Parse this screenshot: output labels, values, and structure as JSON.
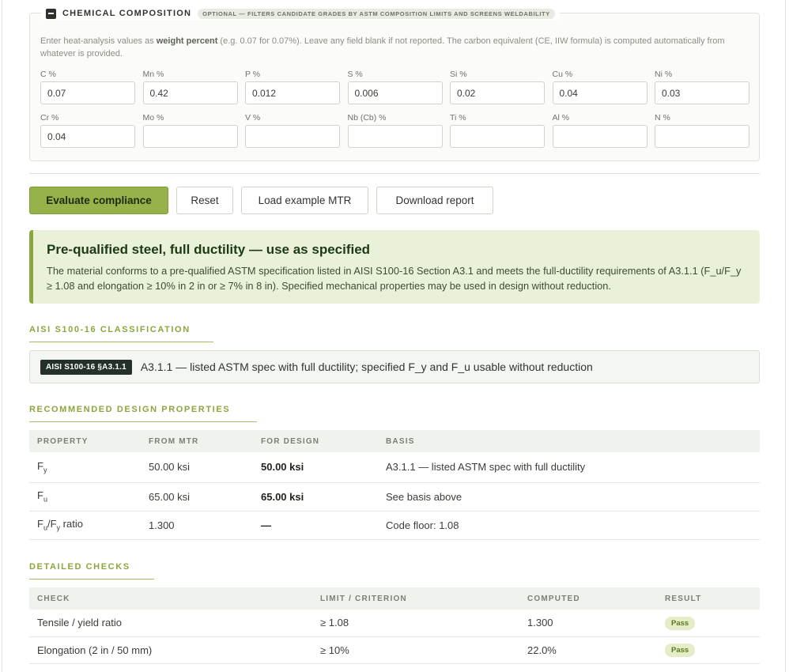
{
  "composition": {
    "title": "CHEMICAL COMPOSITION",
    "pill": "OPTIONAL — FILTERS CANDIDATE GRADES BY ASTM COMPOSITION LIMITS AND SCREENS WELDABILITY",
    "hint_pre": "Enter heat-analysis values as ",
    "hint_bold": "weight percent",
    "hint_post": " (e.g. 0.07 for 0.07%). Leave any field blank if not reported. The carbon equivalent (CE, IIW formula) is computed automatically from whatever is provided.",
    "fields": [
      {
        "label": "C %",
        "value": "0.07"
      },
      {
        "label": "Mn %",
        "value": "0.42"
      },
      {
        "label": "P %",
        "value": "0.012"
      },
      {
        "label": "S %",
        "value": "0.006"
      },
      {
        "label": "Si %",
        "value": "0.02"
      },
      {
        "label": "Cu %",
        "value": "0.04"
      },
      {
        "label": "Ni %",
        "value": "0.03"
      },
      {
        "label": "Cr %",
        "value": "0.04"
      },
      {
        "label": "Mo %",
        "value": ""
      },
      {
        "label": "V %",
        "value": ""
      },
      {
        "label": "Nb (Cb) %",
        "value": ""
      },
      {
        "label": "Ti %",
        "value": ""
      },
      {
        "label": "Al %",
        "value": ""
      },
      {
        "label": "N %",
        "value": ""
      }
    ]
  },
  "actions": {
    "evaluate": "Evaluate compliance",
    "reset": "Reset",
    "load_example": "Load example MTR",
    "download": "Download report"
  },
  "result": {
    "heading": "Pre-qualified steel, full ductility — use as specified",
    "body": "The material conforms to a pre-qualified ASTM specification listed in AISI S100-16 Section A3.1 and meets the full-ductility requirements of A3.1.1 (F_u/F_y ≥ 1.08 and elongation ≥ 10% in 2 in or ≥ 7% in 8 in). Specified mechanical properties may be used in design without reduction."
  },
  "classification": {
    "section_title": "AISI S100-16 CLASSIFICATION",
    "badge": "AISI S100-16 §A3.1.1",
    "text": "A3.1.1 — listed ASTM spec with full ductility; specified F_y and F_u usable without reduction"
  },
  "design": {
    "section_title": "RECOMMENDED DESIGN PROPERTIES",
    "headers": [
      "PROPERTY",
      "FROM MTR",
      "FOR DESIGN",
      "BASIS"
    ],
    "rows": [
      {
        "prop": "F",
        "sub": "y",
        "mtr": "50.00 ksi",
        "design": "50.00 ksi",
        "basis": "A3.1.1 — listed ASTM spec with full ductility"
      },
      {
        "prop": "F",
        "sub": "u",
        "mtr": "65.00 ksi",
        "design": "65.00 ksi",
        "basis": "See basis above"
      },
      {
        "prop": "F",
        "sub": "u",
        "prop2": "/F",
        "sub2": "y",
        "prop3": " ratio",
        "mtr": "1.300",
        "design": "—",
        "basis": "Code floor: 1.08"
      }
    ]
  },
  "checks": {
    "section_title": "DETAILED CHECKS",
    "headers": [
      "CHECK",
      "LIMIT / CRITERION",
      "COMPUTED",
      "RESULT"
    ],
    "rows": [
      {
        "check": "Tensile / yield ratio",
        "limit": "≥ 1.08",
        "computed": "1.300",
        "result": "Pass"
      },
      {
        "check": "Elongation (2 in / 50 mm)",
        "limit": "≥ 10%",
        "computed": "22.0%",
        "result": "Pass"
      }
    ]
  }
}
